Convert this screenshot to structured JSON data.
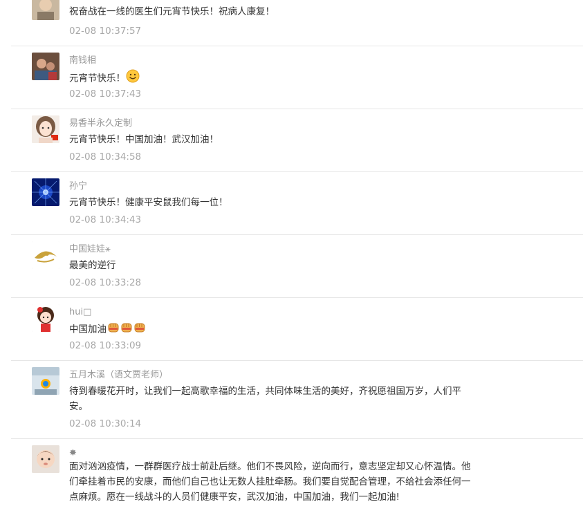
{
  "comments": [
    {
      "name": "",
      "text": "祝奋战在一线的医生们元宵节快乐！祝病人康复！",
      "time": "02-08 10:37:57",
      "avatar": "portrait-avatar",
      "emojis": []
    },
    {
      "name": "南钱相",
      "text": "元宵节快乐！",
      "time": "02-08 10:37:43",
      "avatar": "photo-avatar",
      "emojis": [
        "smile-emoji"
      ]
    },
    {
      "name": "易香半永久定制",
      "text": "元宵节快乐！中国加油！武汉加油！",
      "time": "02-08 10:34:58",
      "avatar": "cartoon-girl-avatar",
      "emojis": []
    },
    {
      "name": "孙宁",
      "text": "元宵节快乐！健康平安鼠我们每一位！",
      "time": "02-08 10:34:43",
      "avatar": "blue-light-avatar",
      "emojis": []
    },
    {
      "name": "中国娃娃⚹",
      "text": "最美的逆行",
      "time": "02-08 10:33:28",
      "avatar": "gold-logo-avatar",
      "emojis": []
    },
    {
      "name": "hui□",
      "text": "中国加油",
      "time": "02-08 10:33:09",
      "avatar": "chibi-girl-avatar",
      "emojis": [
        "fist-emoji",
        "fist-emoji",
        "fist-emoji"
      ]
    },
    {
      "name": "五月木溪（语文贾老师）",
      "text": "待到春暖花开时，让我们一起高歌幸福的生活，共同体味生活的美好，齐祝愿祖国万岁，人们平安。",
      "time": "02-08 10:30:14",
      "avatar": "classroom-avatar",
      "emojis": []
    },
    {
      "name": "✸",
      "text": "面对汹汹疫情，一群群医疗战士前赴后继。他们不畏风险，逆向而行，意志坚定却又心怀温情。他们牵挂着市民的安康，而他们自己也让无数人挂肚牵肠。我们要自觉配合管理，不给社会添任何一点麻烦。愿在一线战斗的人员们健康平安，武汉加油，中国加油，我们一起加油!",
      "time": "",
      "avatar": "baby-avatar",
      "emojis": []
    }
  ]
}
